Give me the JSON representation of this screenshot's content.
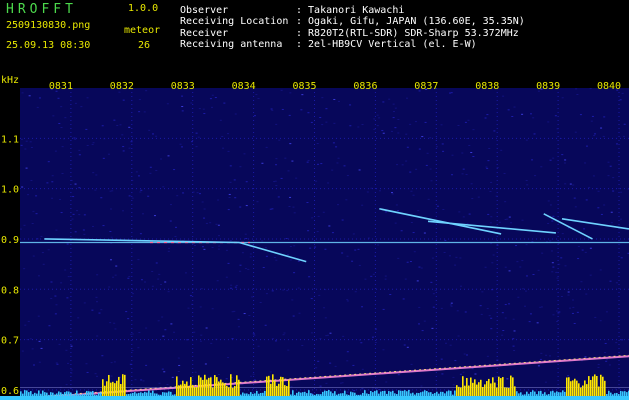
{
  "header": {
    "logo": "HROFFT",
    "version": "1.0.0",
    "filename": "2509130830.png",
    "datetime": "25.09.13 08:30",
    "count_label": "meteor",
    "count": "26",
    "info": [
      {
        "key": "Observer",
        "value": ": Takanori Kawachi"
      },
      {
        "key": "Receiving Location",
        "value": ": Ogaki, Gifu, JAPAN (136.60E, 35.35N)"
      },
      {
        "key": "Receiver",
        "value": ": R820T2(RTL-SDR) SDR-Sharp 53.372MHz"
      },
      {
        "key": "Receiving antenna",
        "value": ": 2el-HB9CV Vertical (el. E-W)"
      }
    ]
  },
  "colors": {
    "background": "#000000",
    "text_yellow": "#e8e800",
    "logo_green": "#4cd94c",
    "noise": "#0a0a6e",
    "echo": "#6fd3ff",
    "activity": "#ffe800",
    "baseline": "#37c8ff"
  },
  "chart_data": {
    "type": "heatmap",
    "unit_label": "kHz",
    "x_ticks": [
      "0831",
      "0832",
      "0833",
      "0834",
      "0835",
      "0836",
      "0837",
      "0838",
      "0839",
      "0840"
    ],
    "y_ticks": [
      "1.1",
      "1.0",
      "0.9",
      "0.8",
      "0.7",
      "0.6"
    ],
    "ylim": [
      0.58,
      1.2
    ],
    "carrier_khz": 0.893,
    "drift_line_khz": [
      0.58,
      0.667
    ],
    "echoes": [
      {
        "t0": 0.4,
        "t1": 3.6,
        "f0": 0.9,
        "f1": 0.893
      },
      {
        "t0": 3.6,
        "t1": 4.7,
        "f0": 0.893,
        "f1": 0.855
      },
      {
        "t0": 5.9,
        "t1": 7.9,
        "f0": 0.96,
        "f1": 0.91
      },
      {
        "t0": 6.7,
        "t1": 8.8,
        "f0": 0.935,
        "f1": 0.912
      },
      {
        "t0": 8.6,
        "t1": 9.4,
        "f0": 0.95,
        "f1": 0.9
      },
      {
        "t0": 8.9,
        "t1": 10.0,
        "f0": 0.94,
        "f1": 0.92
      }
    ]
  }
}
